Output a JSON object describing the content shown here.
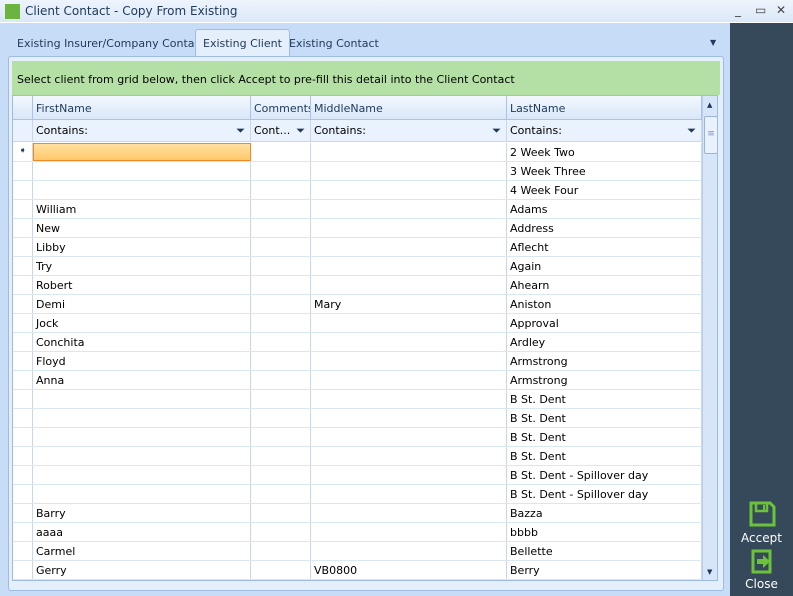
{
  "window": {
    "title": "Client Contact - Copy From Existing",
    "minimize": "_",
    "maximize": "▭",
    "close": "✕"
  },
  "tabs": [
    {
      "label": "Existing Insurer/Company Contact"
    },
    {
      "label": "Existing Client",
      "active": true
    },
    {
      "label": "Existing Contact"
    }
  ],
  "banner": "Select client from grid below, then click Accept to pre-fill this detail into the Client Contact",
  "grid": {
    "columns": [
      "FirstName",
      "Comments",
      "MiddleName",
      "LastName"
    ],
    "filters": [
      "Contains:",
      "Cont...",
      "Contains:",
      "Contains:"
    ],
    "rows": [
      [
        "",
        "",
        "",
        "2 Week Two"
      ],
      [
        "",
        "",
        "",
        "3 Week Three"
      ],
      [
        "",
        "",
        "",
        "4 Week Four"
      ],
      [
        "William",
        "",
        "",
        "Adams"
      ],
      [
        "New",
        "",
        "",
        "Address"
      ],
      [
        "Libby",
        "",
        "",
        "Aflecht"
      ],
      [
        "Try",
        "",
        "",
        "Again"
      ],
      [
        "Robert",
        "",
        "",
        "Ahearn"
      ],
      [
        "Demi",
        "",
        "Mary",
        "Aniston"
      ],
      [
        "Jock",
        "",
        "",
        "Approval"
      ],
      [
        "Conchita",
        "",
        "",
        "Ardley"
      ],
      [
        "Floyd",
        "",
        "",
        "Armstrong"
      ],
      [
        "Anna",
        "",
        "",
        "Armstrong"
      ],
      [
        "",
        "",
        "",
        "B St. Dent"
      ],
      [
        "",
        "",
        "",
        "B St. Dent"
      ],
      [
        "",
        "",
        "",
        "B St. Dent"
      ],
      [
        "",
        "",
        "",
        "B St. Dent"
      ],
      [
        "",
        "",
        "",
        "B St. Dent - Spillover day"
      ],
      [
        "",
        "",
        "",
        "B St. Dent - Spillover day"
      ],
      [
        "Barry",
        "",
        "",
        "Bazza"
      ],
      [
        "aaaa",
        "",
        "",
        "bbbb"
      ],
      [
        "Carmel",
        "",
        "",
        "Bellette"
      ],
      [
        "Gerry",
        "",
        "VB0800",
        "Berry"
      ]
    ]
  },
  "actions": {
    "accept": "Accept",
    "close": "Close"
  },
  "colors": {
    "banner": "#b5e0a5",
    "sidebar": "#36495a",
    "icon": "#6cc33a"
  }
}
